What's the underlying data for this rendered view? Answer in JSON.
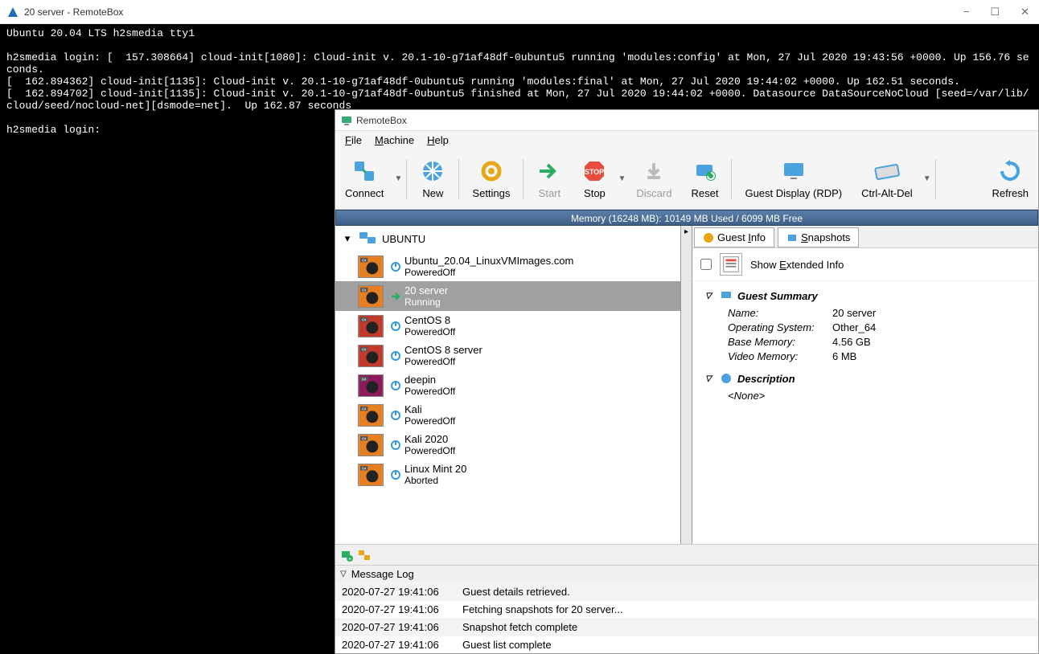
{
  "terminal": {
    "title": "20 server - RemoteBox",
    "lines": "Ubuntu 20.04 LTS h2smedia tty1\n\nh2smedia login: [  157.308664] cloud-init[1080]: Cloud-init v. 20.1-10-g71af48df-0ubuntu5 running 'modules:config' at Mon, 27 Jul 2020 19:43:56 +0000. Up 156.76 seconds.\n[  162.894362] cloud-init[1135]: Cloud-init v. 20.1-10-g71af48df-0ubuntu5 running 'modules:final' at Mon, 27 Jul 2020 19:44:02 +0000. Up 162.51 seconds.\n[  162.894702] cloud-init[1135]: Cloud-init v. 20.1-10-g71af48df-0ubuntu5 finished at Mon, 27 Jul 2020 19:44:02 +0000. Datasource DataSourceNoCloud [seed=/var/lib/cloud/seed/nocloud-net][dsmode=net].  Up 162.87 seconds\n\nh2smedia login:"
  },
  "remotebox": {
    "title": "RemoteBox",
    "menu": {
      "file": "File",
      "machine": "Machine",
      "help": "Help"
    },
    "toolbar": {
      "connect": "Connect",
      "new": "New",
      "settings": "Settings",
      "start": "Start",
      "stop": "Stop",
      "discard": "Discard",
      "reset": "Reset",
      "guest_display": "Guest Display (RDP)",
      "ctrl_alt_del": "Ctrl-Alt-Del",
      "refresh": "Refresh"
    },
    "memory_bar": "Memory (16248 MB): 10149 MB Used / 6099 MB Free",
    "group_name": "UBUNTU",
    "vms": [
      {
        "name": "Ubuntu_20.04_LinuxVMImages.com",
        "state": "PoweredOff",
        "selected": false,
        "color": "#e67e22"
      },
      {
        "name": "20 server",
        "state": "Running",
        "selected": true,
        "color": "#e67e22"
      },
      {
        "name": "CentOS 8",
        "state": "PoweredOff",
        "selected": false,
        "color": "#c0392b"
      },
      {
        "name": "CentOS 8 server",
        "state": "PoweredOff",
        "selected": false,
        "color": "#c0392b"
      },
      {
        "name": "deepin",
        "state": "PoweredOff",
        "selected": false,
        "color": "#8e1a5c"
      },
      {
        "name": "Kali",
        "state": "PoweredOff",
        "selected": false,
        "color": "#e67e22"
      },
      {
        "name": "Kali 2020",
        "state": "PoweredOff",
        "selected": false,
        "color": "#e67e22"
      },
      {
        "name": "Linux Mint 20",
        "state": "Aborted",
        "selected": false,
        "color": "#e67e22"
      }
    ],
    "tabs": {
      "guest_info": "Guest Info",
      "snapshots": "Snapshots"
    },
    "show_extended": "Show Extended Info",
    "summary": {
      "heading": "Guest Summary",
      "name_label": "Name:",
      "name_value": "20 server",
      "os_label": "Operating System:",
      "os_value": "Other_64",
      "mem_label": "Base Memory:",
      "mem_value": "4.56 GB",
      "vid_label": "Video Memory:",
      "vid_value": "6 MB"
    },
    "description": {
      "heading": "Description",
      "value": "<None>"
    },
    "log_heading": "Message Log",
    "log": [
      {
        "ts": "2020-07-27 19:41:06",
        "msg": "Guest details retrieved."
      },
      {
        "ts": "2020-07-27 19:41:06",
        "msg": "Fetching snapshots for 20 server..."
      },
      {
        "ts": "2020-07-27 19:41:06",
        "msg": "Snapshot fetch complete"
      },
      {
        "ts": "2020-07-27 19:41:06",
        "msg": "Guest list complete"
      }
    ]
  }
}
